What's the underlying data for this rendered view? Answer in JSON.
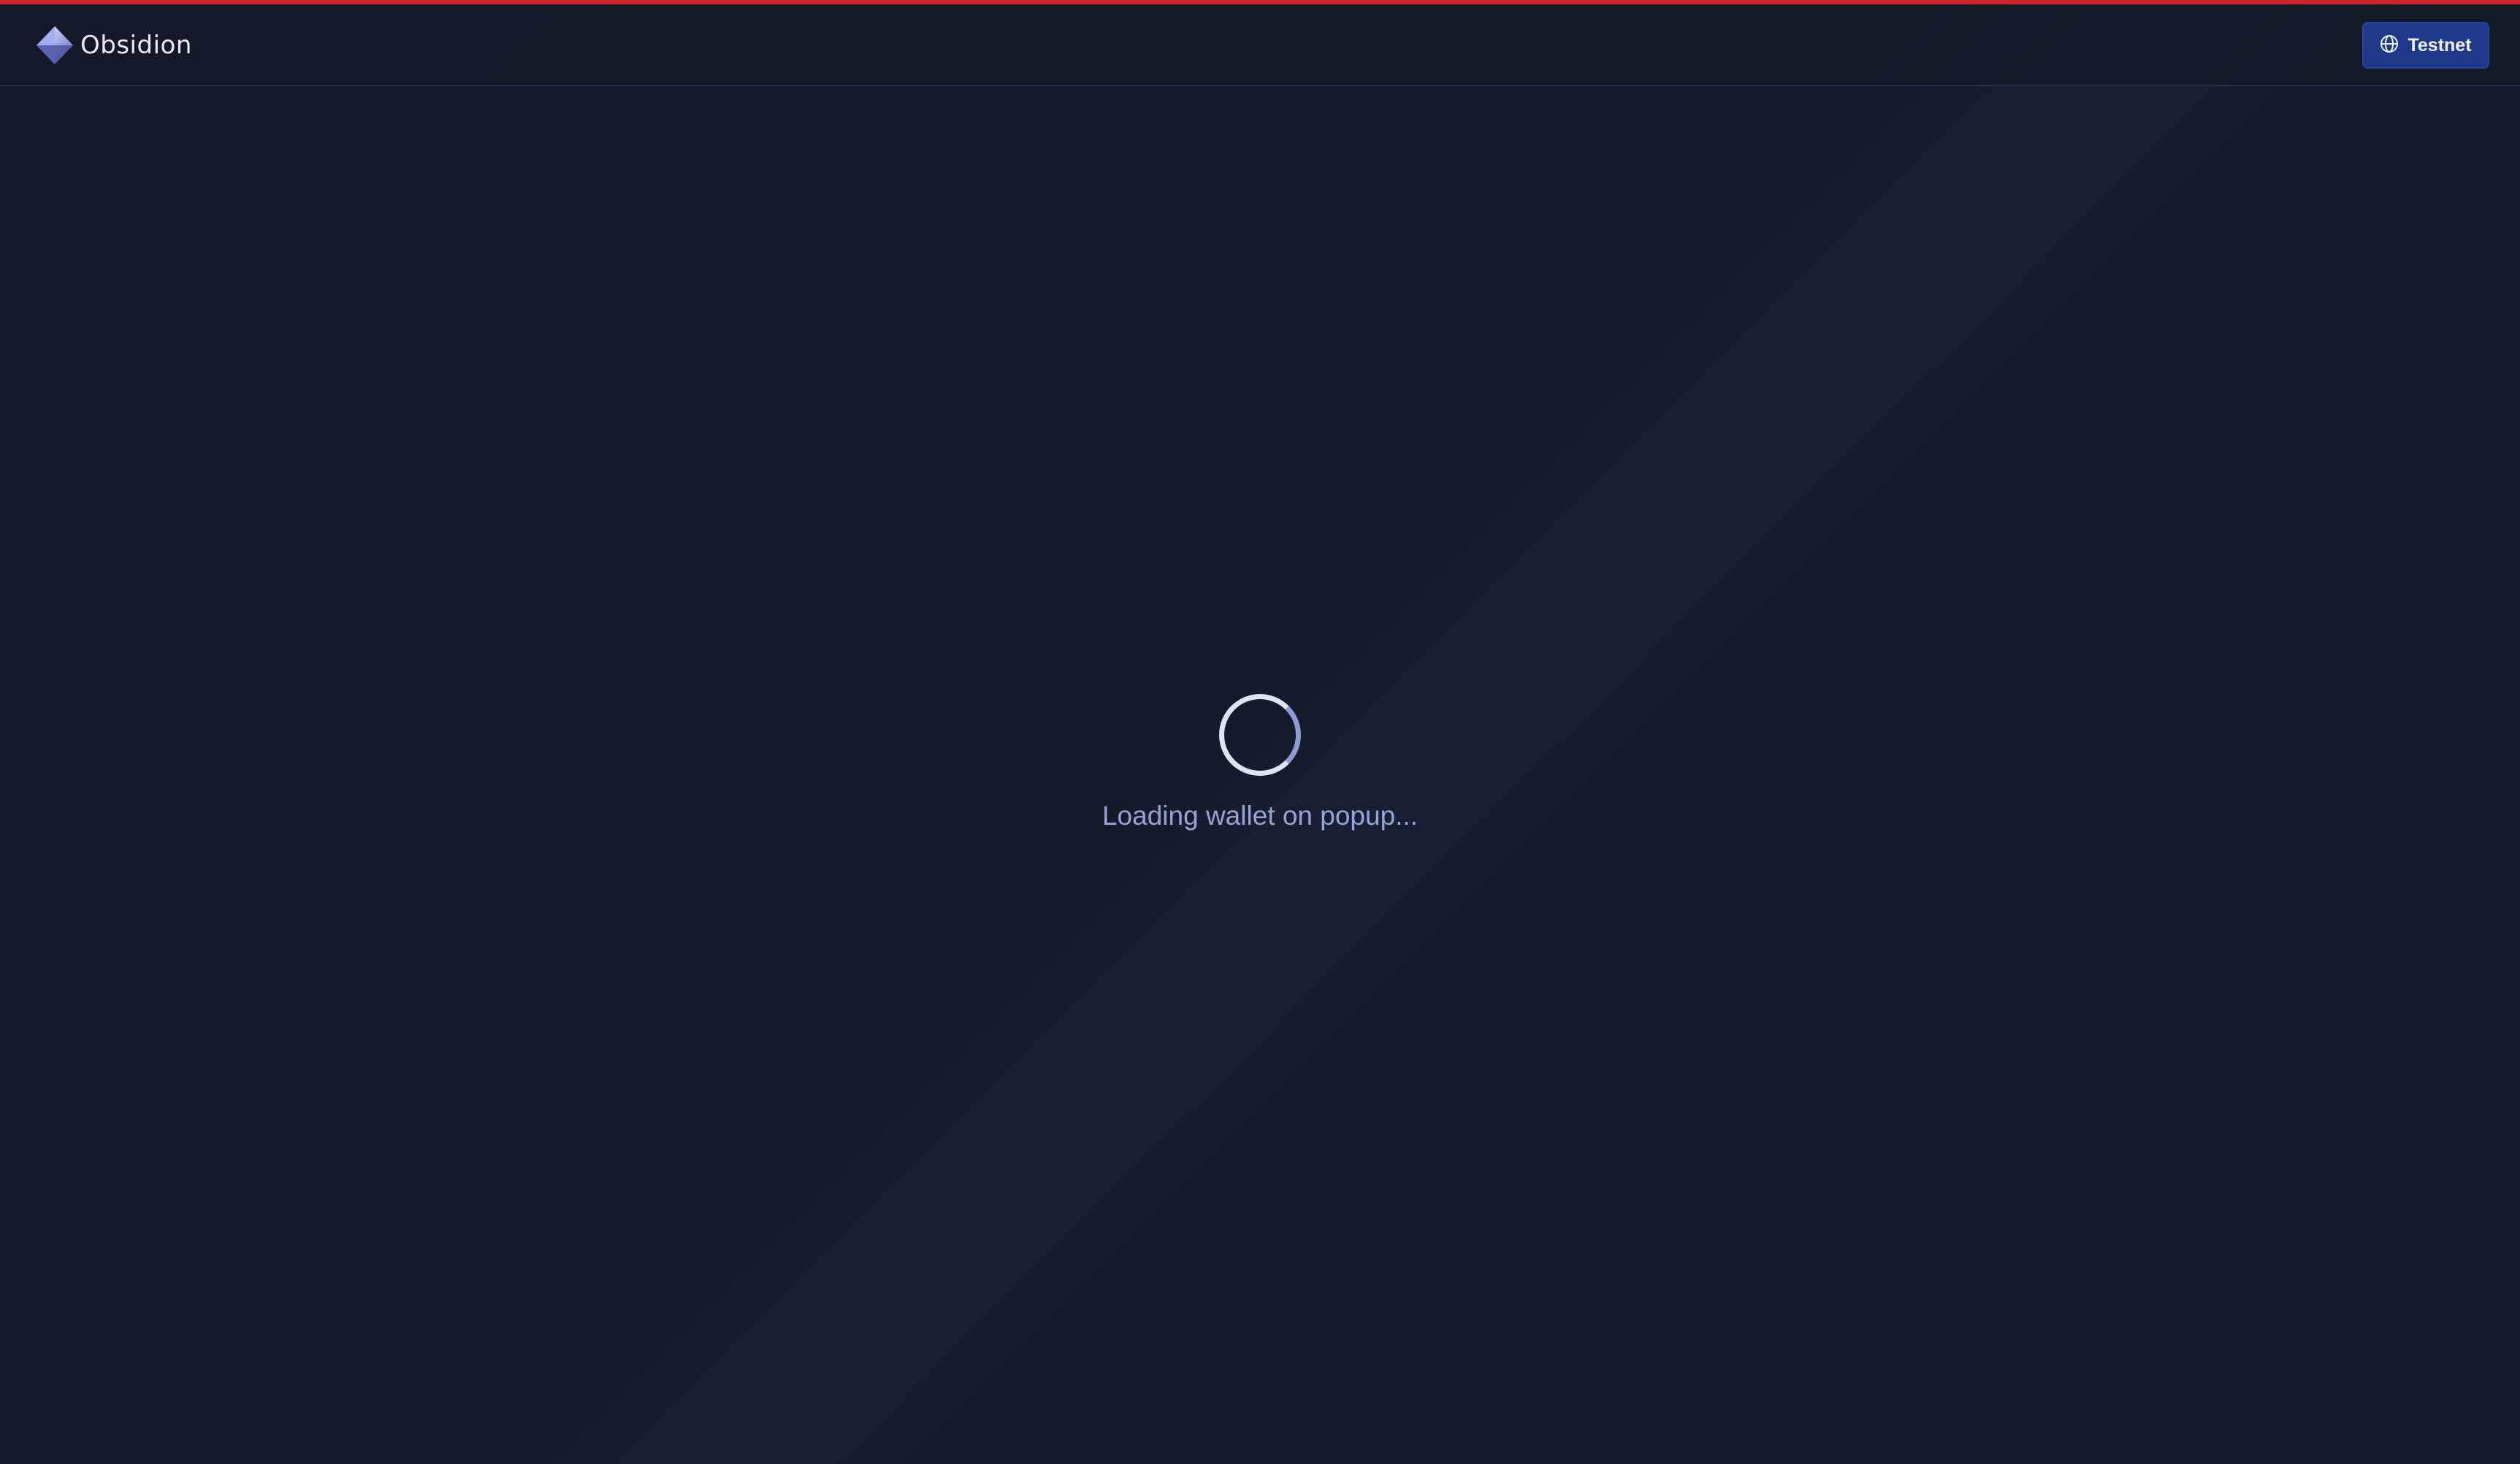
{
  "header": {
    "brand_name": "Obsidion",
    "logo_icon": "diamond-logo-icon",
    "network_button": {
      "label": "Testnet",
      "icon": "globe-icon"
    }
  },
  "main": {
    "loading_text": "Loading wallet on popup..."
  },
  "colors": {
    "background": "#131a29",
    "top_accent": "#d0242c",
    "button": "#1f3a8a",
    "loading_text": "#9aa3d4"
  }
}
